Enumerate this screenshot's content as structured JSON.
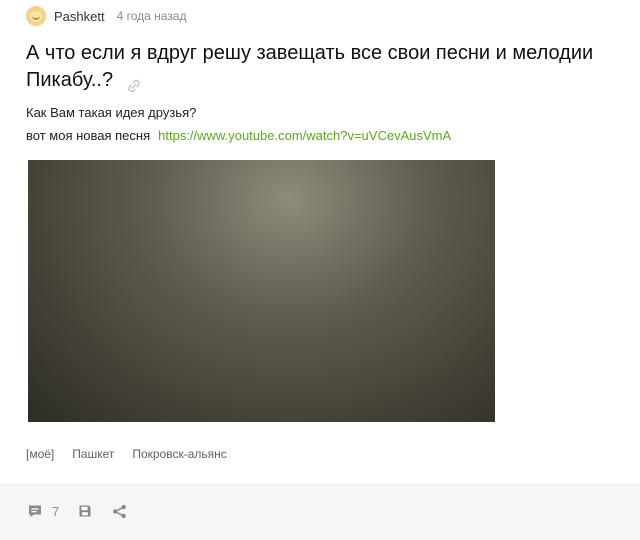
{
  "post": {
    "author": "Pashkett",
    "time": "4 года назад",
    "title": "А что если я вдруг решу завещать все свои песни и мелодии Пикабу..?",
    "text_line_1": "Как Вам такая идея друзья?",
    "text_line_2": "вот моя новая песня",
    "video_link": "https://www.youtube.com/watch?v=uVCevAusVmA",
    "tags": [
      "[моё]",
      "Пашкет",
      "Покровск-альянс"
    ]
  },
  "footer": {
    "comment_count": "7"
  },
  "icons": {
    "avatar": "avatar-icon",
    "link": "link-icon",
    "comment": "comment-icon",
    "save": "save-icon",
    "share": "share-icon"
  },
  "colors": {
    "link": "#5aa91e",
    "muted": "#8a8a8a",
    "footer_bg": "#f6f6f6"
  }
}
